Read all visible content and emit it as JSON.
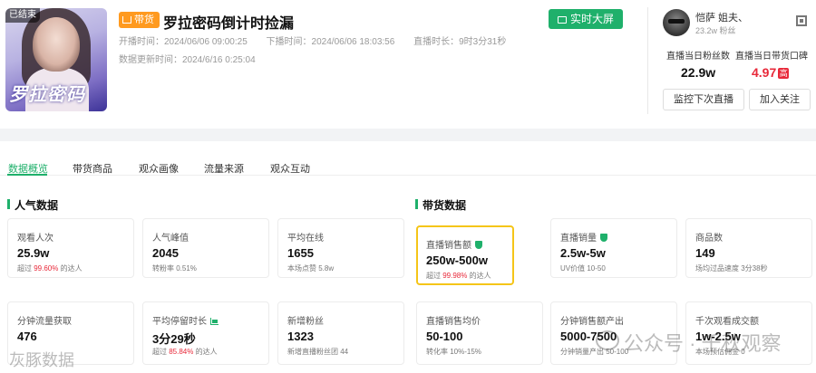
{
  "cover": {
    "badge": "已结束",
    "title": "罗拉密码"
  },
  "header": {
    "tag": "带货",
    "title": "罗拉密码倒计时捡漏",
    "start": "开播时间：2024/06/06 09:00:25",
    "end": "下播时间：2024/06/06 18:03:56",
    "duration": "直播时长：9时3分31秒",
    "updated": "数据更新时间：2024/6/16 0:25:04",
    "bigscreen_label": "实时大屏"
  },
  "streamer": {
    "name": "恺萨 姐夫、",
    "fans": "23.2w 粉丝",
    "fans_day_label": "直播当日粉丝数",
    "fans_day_value": "22.9w",
    "reputation_label": "直播当日带货口碑",
    "reputation_value": "4.97",
    "reputation_badge": "高",
    "monitor_label": "监控下次直播",
    "follow_label": "加入关注"
  },
  "tabs": [
    "数据概览",
    "带货商品",
    "观众画像",
    "流量来源",
    "观众互动"
  ],
  "sections": {
    "popularity": "人气数据",
    "sales": "带货数据"
  },
  "cards": {
    "viewers": {
      "label": "观看人次",
      "value": "25.9w",
      "sub_pre": "超过",
      "sub_hl": "99.60%",
      "sub_post": "的达人"
    },
    "peak": {
      "label": "人气峰值",
      "value": "2045",
      "sub": "转粉率 0.51%"
    },
    "avg_online": {
      "label": "平均在线",
      "value": "1655",
      "sub": "本场点赞 5.8w"
    },
    "sales_amount": {
      "label": "直播销售额",
      "value": "250w-500w",
      "sub_pre": "超过",
      "sub_hl": "99.98%",
      "sub_post": "的达人"
    },
    "sales_volume": {
      "label": "直播销量",
      "value": "2.5w-5w",
      "sub": "UV价值 10-50"
    },
    "products": {
      "label": "商品数",
      "value": "149",
      "sub": "场均过品速度 3分38秒"
    },
    "traffic": {
      "label": "分钟流量获取",
      "value": "476",
      "sub": ""
    },
    "stay": {
      "label": "平均停留时长",
      "value": "3分29秒",
      "sub_pre": "超过",
      "sub_hl": "85.84%",
      "sub_post": "的达人"
    },
    "new_fans": {
      "label": "新增粉丝",
      "value": "1323",
      "sub": "新增直播粉丝团 44"
    },
    "avg_price": {
      "label": "直播销售均价",
      "value": "50-100",
      "sub": "转化率 10%-15%"
    },
    "minute_sales": {
      "label": "分钟销售额产出",
      "value": "5000-7500",
      "sub": "分钟销量产出 50-100"
    },
    "thousand": {
      "label": "千次观看成交额",
      "value": "1w-2.5w",
      "sub": "本场预估佣金 0"
    }
  },
  "watermark": {
    "left": "灰豚数据",
    "right": "公众号 · 千秋观察"
  }
}
